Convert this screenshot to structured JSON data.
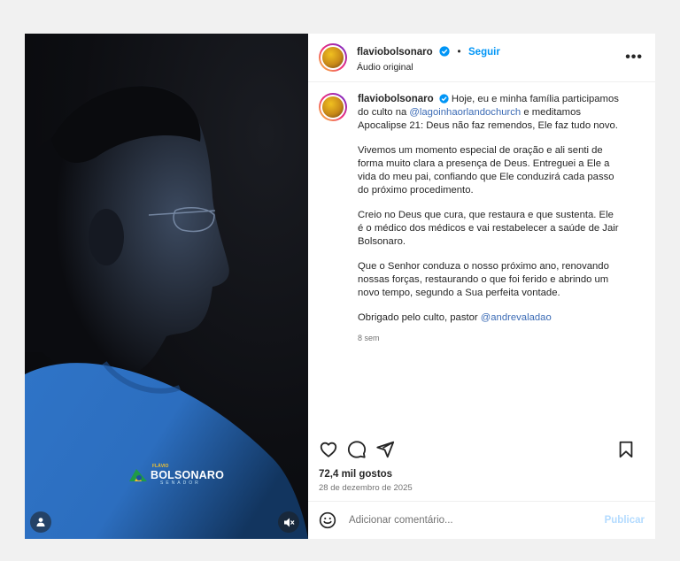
{
  "post": {
    "username": "flaviobolsonaro",
    "follow_label": "Seguir",
    "separator": "•",
    "audio_label": "Áudio original",
    "more_label": "•••"
  },
  "caption": {
    "username": "flaviobolsonaro",
    "p1_text_a": " Hoje, eu e minha família participamos do culto na ",
    "p1_mention": "@lagoinhaorlandochurch",
    "p1_text_b": " e meditamos Apocalipse 21: Deus não faz remendos, Ele faz tudo novo.",
    "p2": "Vivemos um momento especial de oração e ali senti de forma muito clara a presença de Deus. Entreguei a Ele a vida do meu pai, confiando que Ele conduzirá cada passo do próximo procedimento.",
    "p3": "Creio no Deus que cura, que restaura e que sustenta. Ele é o médico dos médicos e vai restabelecer a saúde de Jair Bolsonaro.",
    "p4": "Que o Senhor conduza o nosso próximo ano, renovando nossas forças, restaurando o que foi ferido e abrindo um novo tempo, segundo a Sua perfeita vontade.",
    "p5_text": "Obrigado pelo culto, pastor ",
    "p5_mention": "@andrevaladao",
    "time_ago": "8 sem"
  },
  "engagement": {
    "likes": "72,4 mil gostos",
    "date": "28 de dezembro de 2025"
  },
  "comment": {
    "placeholder": "Adicionar comentário...",
    "publish_label": "Publicar"
  },
  "media_overlay": {
    "logo_kicker": "FLÁVIO",
    "logo_text": "BOLSONARO",
    "logo_sub": "SENADOR"
  },
  "icons": {
    "header_avatar": "profile-avatar",
    "verified": "verified-badge-icon",
    "like": "heart-icon",
    "comment": "comment-bubble-icon",
    "share": "send-icon",
    "save": "bookmark-icon",
    "emoji": "smiley-icon",
    "user_tag": "person-icon",
    "mute": "speaker-muted-icon"
  },
  "colors": {
    "link": "#00376b",
    "follow": "#0095f6",
    "publish_disabled": "#b3dbff",
    "verified": "#0095f6"
  }
}
